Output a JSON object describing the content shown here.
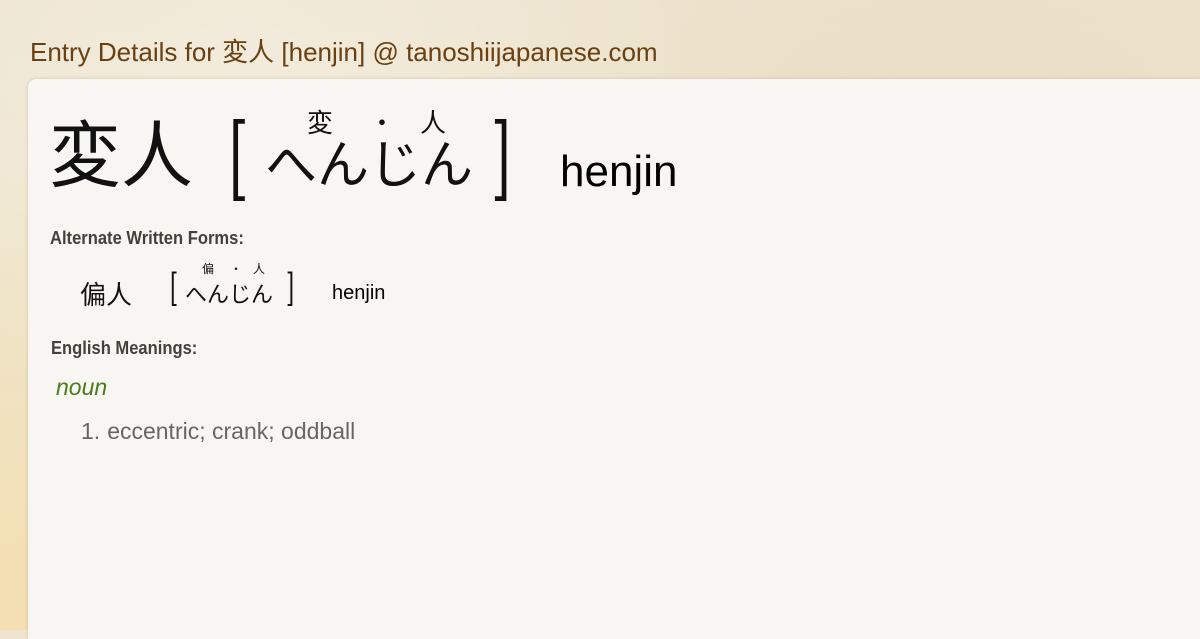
{
  "header": {
    "title": "Entry Details for 変人 [henjin] @ tanoshiijapanese.com"
  },
  "entry": {
    "kanji": "変人",
    "bracket_open": "[",
    "bracket_close": "]",
    "furigana": [
      "変",
      "・",
      "人"
    ],
    "kana": "へんじん",
    "romaji": "henjin"
  },
  "alternate_forms": {
    "label": "Alternate Written Forms:",
    "items": [
      {
        "kanji": "偏人",
        "furigana": [
          "偏",
          "・",
          "人"
        ],
        "kana": "へんじん",
        "romaji": "henjin"
      }
    ]
  },
  "meanings": {
    "label": "English Meanings:",
    "part_of_speech": "noun",
    "items": [
      {
        "number": "1.",
        "text": "eccentric; crank; oddball"
      }
    ]
  },
  "colors": {
    "title": "#6a3f12",
    "label": "#43413a",
    "part_of_speech": "#4b7a1a",
    "meaning": "#666666",
    "card": "#f7f6f2"
  }
}
